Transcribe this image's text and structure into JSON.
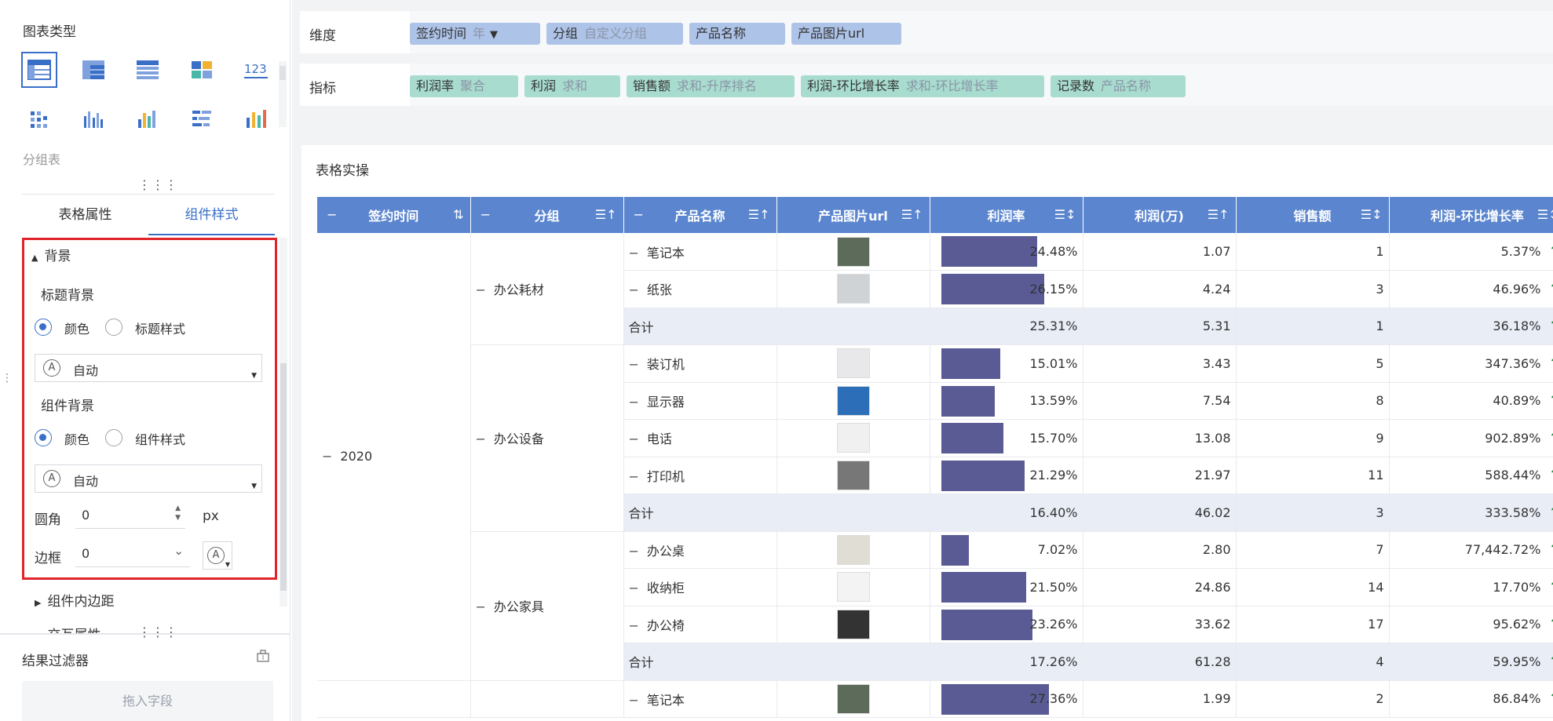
{
  "left_panel": {
    "chart_type_title": "图表类型",
    "group_label": "分组表",
    "tabs": [
      "表格属性",
      "组件样式"
    ],
    "background_section": "背景",
    "title_bg_label": "标题背景",
    "title_bg_options": [
      "颜色",
      "标题样式"
    ],
    "title_bg_value": "自动",
    "widget_bg_label": "组件背景",
    "widget_bg_options": [
      "颜色",
      "组件样式"
    ],
    "widget_bg_value": "自动",
    "radius_label": "圆角",
    "radius_value": "0",
    "radius_unit": "px",
    "border_label": "边框",
    "border_value": "0",
    "padding_section": "组件内边距",
    "interaction_section": "交互属性",
    "result_filter_title": "结果过滤器",
    "drop_field_placeholder": "拖入字段"
  },
  "shelves": {
    "dimension_label": "维度",
    "dimension_pills": [
      {
        "name": "签约时间",
        "sub": "年"
      },
      {
        "name": "分组",
        "sub": "自定义分组"
      },
      {
        "name": "产品名称",
        "sub": ""
      },
      {
        "name": "产品图片url",
        "sub": ""
      }
    ],
    "measure_label": "指标",
    "measure_pills": [
      {
        "name": "利润率",
        "sub": "聚合"
      },
      {
        "name": "利润",
        "sub": "求和"
      },
      {
        "name": "销售额",
        "sub": "求和-升序排名"
      },
      {
        "name": "利润-环比增长率",
        "sub": "求和-环比增长率"
      },
      {
        "name": "记录数",
        "sub": "产品名称"
      }
    ]
  },
  "canvas": {
    "title": "表格实操",
    "headers": [
      "签约时间",
      "分组",
      "产品名称",
      "产品图片url",
      "利润率",
      "利润(万)",
      "销售额",
      "利润-环比增长率"
    ],
    "year": "2020",
    "subtotal_label": "合计",
    "groups": [
      {
        "name": "办公耗材",
        "rows": [
          {
            "product": "笔记本",
            "rate": "24.48%",
            "rate_val": 24.48,
            "profit": "1.07",
            "sales": "1",
            "growth": "5.37%"
          },
          {
            "product": "纸张",
            "rate": "26.15%",
            "rate_val": 26.15,
            "profit": "4.24",
            "sales": "3",
            "growth": "46.96%"
          }
        ],
        "subtotal": {
          "rate": "25.31%",
          "profit": "5.31",
          "sales": "1",
          "growth": "36.18%"
        }
      },
      {
        "name": "办公设备",
        "rows": [
          {
            "product": "装订机",
            "rate": "15.01%",
            "rate_val": 15.01,
            "profit": "3.43",
            "sales": "5",
            "growth": "347.36%"
          },
          {
            "product": "显示器",
            "rate": "13.59%",
            "rate_val": 13.59,
            "profit": "7.54",
            "sales": "8",
            "growth": "40.89%"
          },
          {
            "product": "电话",
            "rate": "15.70%",
            "rate_val": 15.7,
            "profit": "13.08",
            "sales": "9",
            "growth": "902.89%"
          },
          {
            "product": "打印机",
            "rate": "21.29%",
            "rate_val": 21.29,
            "profit": "21.97",
            "sales": "11",
            "growth": "588.44%"
          }
        ],
        "subtotal": {
          "rate": "16.40%",
          "profit": "46.02",
          "sales": "3",
          "growth": "333.58%"
        }
      },
      {
        "name": "办公家具",
        "rows": [
          {
            "product": "办公桌",
            "rate": "7.02%",
            "rate_val": 7.02,
            "profit": "2.80",
            "sales": "7",
            "growth": "77,442.72%"
          },
          {
            "product": "收纳柜",
            "rate": "21.50%",
            "rate_val": 21.5,
            "profit": "24.86",
            "sales": "14",
            "growth": "17.70%"
          },
          {
            "product": "办公椅",
            "rate": "23.26%",
            "rate_val": 23.26,
            "profit": "33.62",
            "sales": "17",
            "growth": "95.62%"
          }
        ],
        "subtotal": {
          "rate": "17.26%",
          "profit": "61.28",
          "sales": "4",
          "growth": "59.95%"
        }
      },
      {
        "name": "",
        "rows": [
          {
            "product": "笔记本",
            "rate": "27.36%",
            "rate_val": 27.36,
            "profit": "1.99",
            "sales": "2",
            "growth": "86.84%"
          }
        ]
      }
    ],
    "colors": {
      "header": "#5b86cf",
      "bar": "#5a5b94",
      "subtotal_bg": "#e9edf6",
      "up_arrow": "#1a8a3e",
      "highlight": "#e0242a"
    }
  }
}
